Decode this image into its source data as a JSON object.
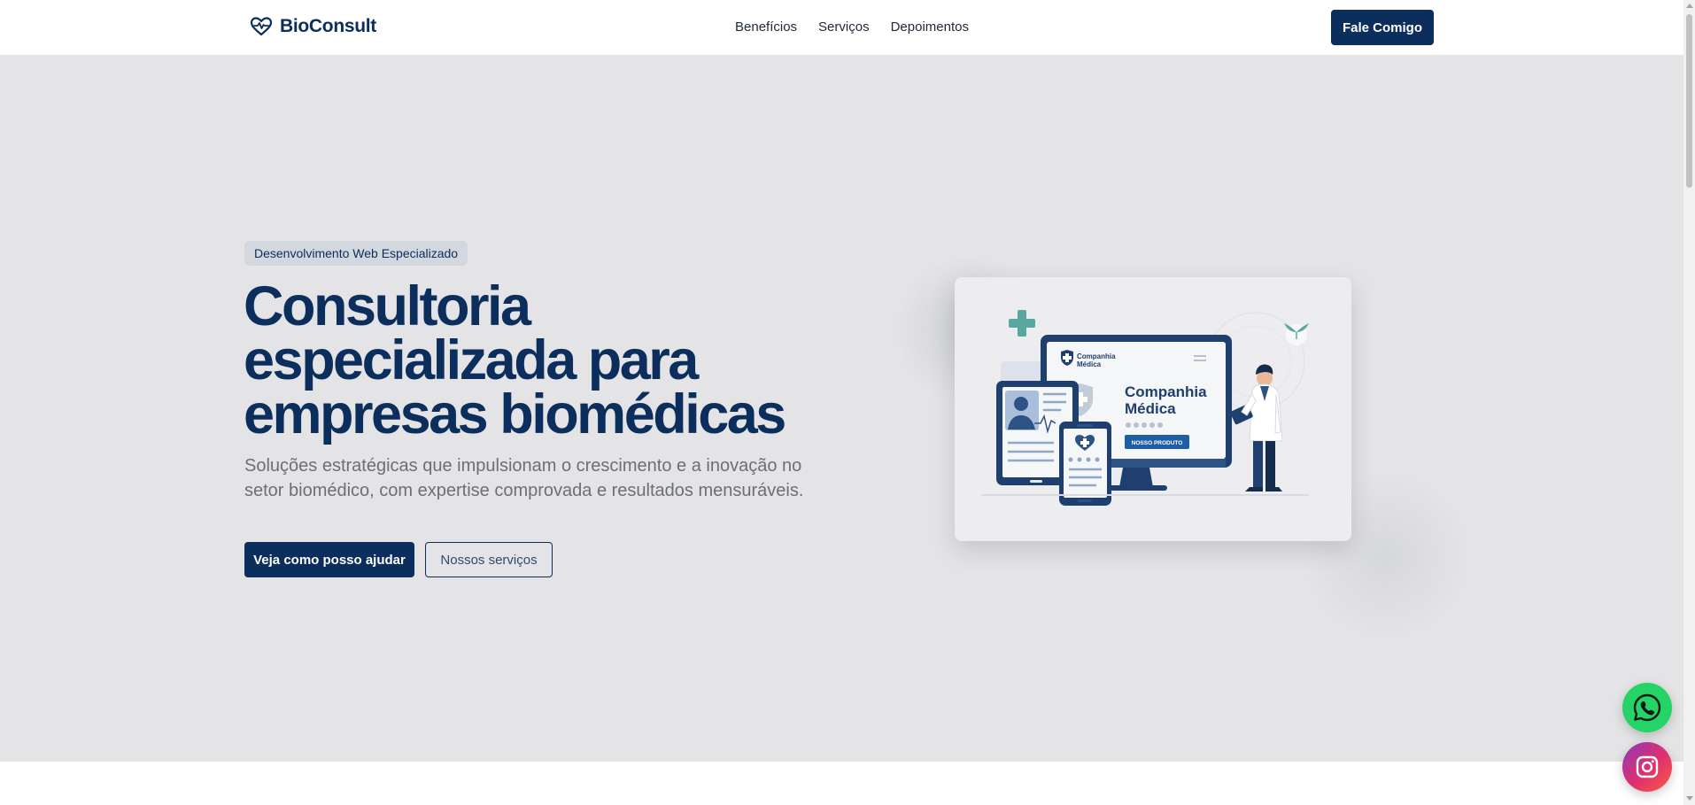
{
  "header": {
    "brand_name": "BioConsult",
    "nav": [
      "Benefícios",
      "Serviços",
      "Depoimentos"
    ],
    "cta_label": "Fale Comigo"
  },
  "hero": {
    "badge": "Desenvolvimento Web Especializado",
    "headline": "Consultoria especializada para empresas biomédicas",
    "subtext": "Soluções estratégicas que impulsionam o crescimento e a inovação no setor biomédico, com expertise comprovada e resultados mensuráveis.",
    "primary_button": "Veja como posso ajudar",
    "secondary_button": "Nossos serviços"
  },
  "illustration": {
    "logo_text": "Companhia Médica",
    "screen_title_line1": "Companhia",
    "screen_title_line2": "Médica",
    "screen_button": "NOSSO PRODUTO"
  },
  "floating": {
    "whatsapp_icon": "whatsapp-icon",
    "instagram_icon": "instagram-icon"
  },
  "colors": {
    "brand": "#0b2e5c",
    "hero_bg": "#e4e4e6",
    "whatsapp": "#25d366"
  }
}
